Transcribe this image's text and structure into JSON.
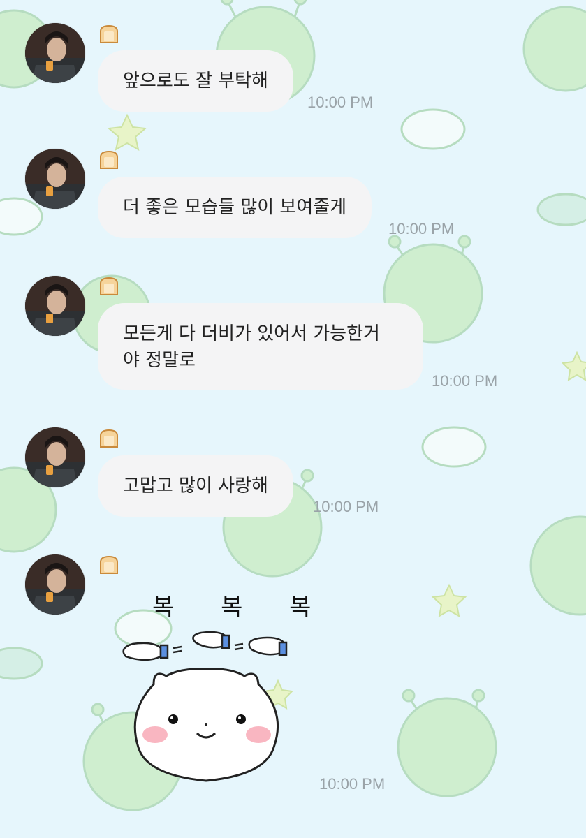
{
  "chat": {
    "messages": [
      {
        "text": "앞으로도 잘 부탁해",
        "time": "10:00 PM"
      },
      {
        "text": "더 좋은 모습들 많이 보여줄게",
        "time": "10:00 PM"
      },
      {
        "text": "모든게 다 더비가 있어서 가능한거\n야 정말로",
        "time": "10:00 PM"
      },
      {
        "text": "고맙고 많이 사랑해",
        "time": "10:00 PM"
      }
    ],
    "sticker": {
      "caption": "복 복 복",
      "time": "10:00 PM",
      "icon": "bunny-pat-sticker"
    }
  },
  "colors": {
    "background": "#e6f6fc",
    "bubble": "#f4f4f5",
    "timestamp": "#9aa3a8"
  },
  "icons": {
    "badge": "bread-icon",
    "avatar": "profile-photo"
  }
}
